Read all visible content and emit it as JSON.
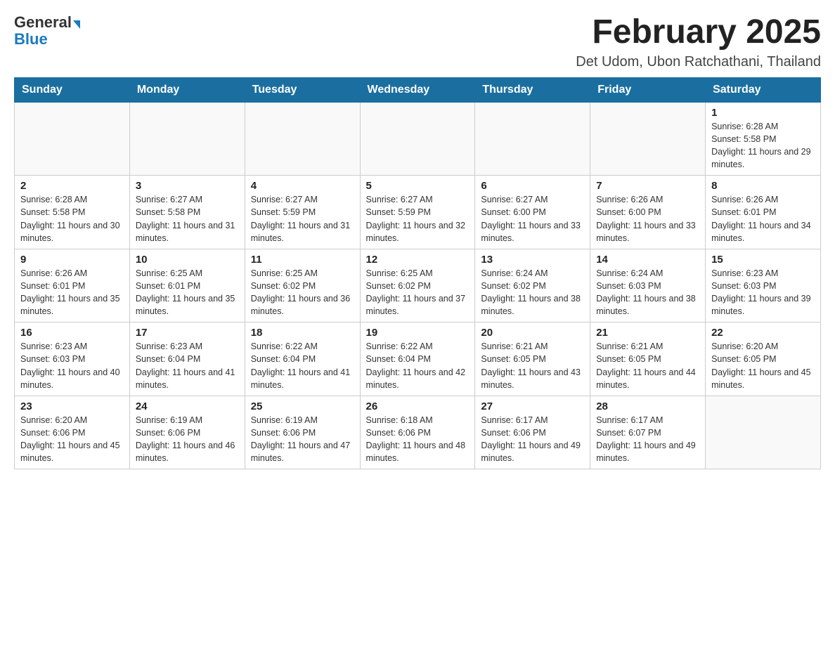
{
  "header": {
    "logo_general": "General",
    "logo_blue": "Blue",
    "title": "February 2025",
    "subtitle": "Det Udom, Ubon Ratchathani, Thailand"
  },
  "days_of_week": [
    "Sunday",
    "Monday",
    "Tuesday",
    "Wednesday",
    "Thursday",
    "Friday",
    "Saturday"
  ],
  "weeks": [
    [
      {
        "day": "",
        "sunrise": "",
        "sunset": "",
        "daylight": ""
      },
      {
        "day": "",
        "sunrise": "",
        "sunset": "",
        "daylight": ""
      },
      {
        "day": "",
        "sunrise": "",
        "sunset": "",
        "daylight": ""
      },
      {
        "day": "",
        "sunrise": "",
        "sunset": "",
        "daylight": ""
      },
      {
        "day": "",
        "sunrise": "",
        "sunset": "",
        "daylight": ""
      },
      {
        "day": "",
        "sunrise": "",
        "sunset": "",
        "daylight": ""
      },
      {
        "day": "1",
        "sunrise": "Sunrise: 6:28 AM",
        "sunset": "Sunset: 5:58 PM",
        "daylight": "Daylight: 11 hours and 29 minutes."
      }
    ],
    [
      {
        "day": "2",
        "sunrise": "Sunrise: 6:28 AM",
        "sunset": "Sunset: 5:58 PM",
        "daylight": "Daylight: 11 hours and 30 minutes."
      },
      {
        "day": "3",
        "sunrise": "Sunrise: 6:27 AM",
        "sunset": "Sunset: 5:58 PM",
        "daylight": "Daylight: 11 hours and 31 minutes."
      },
      {
        "day": "4",
        "sunrise": "Sunrise: 6:27 AM",
        "sunset": "Sunset: 5:59 PM",
        "daylight": "Daylight: 11 hours and 31 minutes."
      },
      {
        "day": "5",
        "sunrise": "Sunrise: 6:27 AM",
        "sunset": "Sunset: 5:59 PM",
        "daylight": "Daylight: 11 hours and 32 minutes."
      },
      {
        "day": "6",
        "sunrise": "Sunrise: 6:27 AM",
        "sunset": "Sunset: 6:00 PM",
        "daylight": "Daylight: 11 hours and 33 minutes."
      },
      {
        "day": "7",
        "sunrise": "Sunrise: 6:26 AM",
        "sunset": "Sunset: 6:00 PM",
        "daylight": "Daylight: 11 hours and 33 minutes."
      },
      {
        "day": "8",
        "sunrise": "Sunrise: 6:26 AM",
        "sunset": "Sunset: 6:01 PM",
        "daylight": "Daylight: 11 hours and 34 minutes."
      }
    ],
    [
      {
        "day": "9",
        "sunrise": "Sunrise: 6:26 AM",
        "sunset": "Sunset: 6:01 PM",
        "daylight": "Daylight: 11 hours and 35 minutes."
      },
      {
        "day": "10",
        "sunrise": "Sunrise: 6:25 AM",
        "sunset": "Sunset: 6:01 PM",
        "daylight": "Daylight: 11 hours and 35 minutes."
      },
      {
        "day": "11",
        "sunrise": "Sunrise: 6:25 AM",
        "sunset": "Sunset: 6:02 PM",
        "daylight": "Daylight: 11 hours and 36 minutes."
      },
      {
        "day": "12",
        "sunrise": "Sunrise: 6:25 AM",
        "sunset": "Sunset: 6:02 PM",
        "daylight": "Daylight: 11 hours and 37 minutes."
      },
      {
        "day": "13",
        "sunrise": "Sunrise: 6:24 AM",
        "sunset": "Sunset: 6:02 PM",
        "daylight": "Daylight: 11 hours and 38 minutes."
      },
      {
        "day": "14",
        "sunrise": "Sunrise: 6:24 AM",
        "sunset": "Sunset: 6:03 PM",
        "daylight": "Daylight: 11 hours and 38 minutes."
      },
      {
        "day": "15",
        "sunrise": "Sunrise: 6:23 AM",
        "sunset": "Sunset: 6:03 PM",
        "daylight": "Daylight: 11 hours and 39 minutes."
      }
    ],
    [
      {
        "day": "16",
        "sunrise": "Sunrise: 6:23 AM",
        "sunset": "Sunset: 6:03 PM",
        "daylight": "Daylight: 11 hours and 40 minutes."
      },
      {
        "day": "17",
        "sunrise": "Sunrise: 6:23 AM",
        "sunset": "Sunset: 6:04 PM",
        "daylight": "Daylight: 11 hours and 41 minutes."
      },
      {
        "day": "18",
        "sunrise": "Sunrise: 6:22 AM",
        "sunset": "Sunset: 6:04 PM",
        "daylight": "Daylight: 11 hours and 41 minutes."
      },
      {
        "day": "19",
        "sunrise": "Sunrise: 6:22 AM",
        "sunset": "Sunset: 6:04 PM",
        "daylight": "Daylight: 11 hours and 42 minutes."
      },
      {
        "day": "20",
        "sunrise": "Sunrise: 6:21 AM",
        "sunset": "Sunset: 6:05 PM",
        "daylight": "Daylight: 11 hours and 43 minutes."
      },
      {
        "day": "21",
        "sunrise": "Sunrise: 6:21 AM",
        "sunset": "Sunset: 6:05 PM",
        "daylight": "Daylight: 11 hours and 44 minutes."
      },
      {
        "day": "22",
        "sunrise": "Sunrise: 6:20 AM",
        "sunset": "Sunset: 6:05 PM",
        "daylight": "Daylight: 11 hours and 45 minutes."
      }
    ],
    [
      {
        "day": "23",
        "sunrise": "Sunrise: 6:20 AM",
        "sunset": "Sunset: 6:06 PM",
        "daylight": "Daylight: 11 hours and 45 minutes."
      },
      {
        "day": "24",
        "sunrise": "Sunrise: 6:19 AM",
        "sunset": "Sunset: 6:06 PM",
        "daylight": "Daylight: 11 hours and 46 minutes."
      },
      {
        "day": "25",
        "sunrise": "Sunrise: 6:19 AM",
        "sunset": "Sunset: 6:06 PM",
        "daylight": "Daylight: 11 hours and 47 minutes."
      },
      {
        "day": "26",
        "sunrise": "Sunrise: 6:18 AM",
        "sunset": "Sunset: 6:06 PM",
        "daylight": "Daylight: 11 hours and 48 minutes."
      },
      {
        "day": "27",
        "sunrise": "Sunrise: 6:17 AM",
        "sunset": "Sunset: 6:06 PM",
        "daylight": "Daylight: 11 hours and 49 minutes."
      },
      {
        "day": "28",
        "sunrise": "Sunrise: 6:17 AM",
        "sunset": "Sunset: 6:07 PM",
        "daylight": "Daylight: 11 hours and 49 minutes."
      },
      {
        "day": "",
        "sunrise": "",
        "sunset": "",
        "daylight": ""
      }
    ]
  ]
}
